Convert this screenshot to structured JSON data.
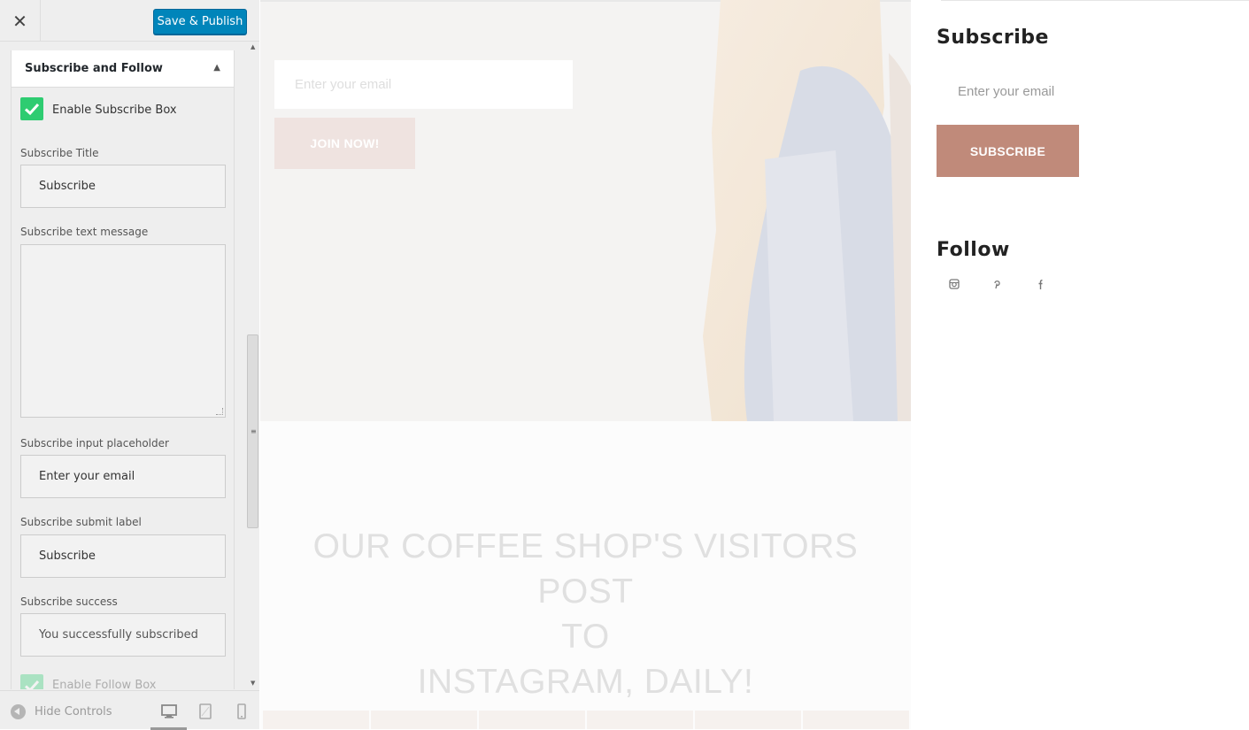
{
  "toolbar": {
    "close_glyph": "✕",
    "publish_label": "Save & Publish"
  },
  "section": {
    "title": "Subscribe and Follow"
  },
  "fields": {
    "enable_subscribe_label": "Enable Subscribe Box",
    "subscribe_title_label": "Subscribe Title",
    "subscribe_title_value": "Subscribe",
    "text_message_label": "Subscribe text message",
    "text_message_value": "",
    "placeholder_label": "Subscribe input placeholder",
    "placeholder_value": "Enter your email",
    "submit_label_label": "Subscribe submit label",
    "submit_label_value": "Subscribe",
    "success_label": "Subscribe success",
    "success_value": "You successfully subscribed",
    "enable_follow_label": "Enable Follow Box"
  },
  "footer": {
    "hide_controls": "Hide Controls"
  },
  "hero": {
    "email_placeholder": "Enter your email",
    "join_button": "JOIN NOW!"
  },
  "instagram": {
    "line1": "OUR COFFEE SHOP'S VISITORS POST",
    "line2": "TO",
    "line3": "INSTAGRAM, DAILY!"
  },
  "widget": {
    "subscribe_title": "Subscribe",
    "email_placeholder": "Enter your email",
    "subscribe_button": "SUBSCRIBE",
    "follow_title": "Follow",
    "social_icons": [
      "instagram-icon",
      "pinterest-icon",
      "facebook-icon"
    ]
  },
  "colors": {
    "publish_blue": "#0085ba",
    "checkbox_green": "#2ecc71",
    "subscribe_button": "#c08a7a"
  }
}
